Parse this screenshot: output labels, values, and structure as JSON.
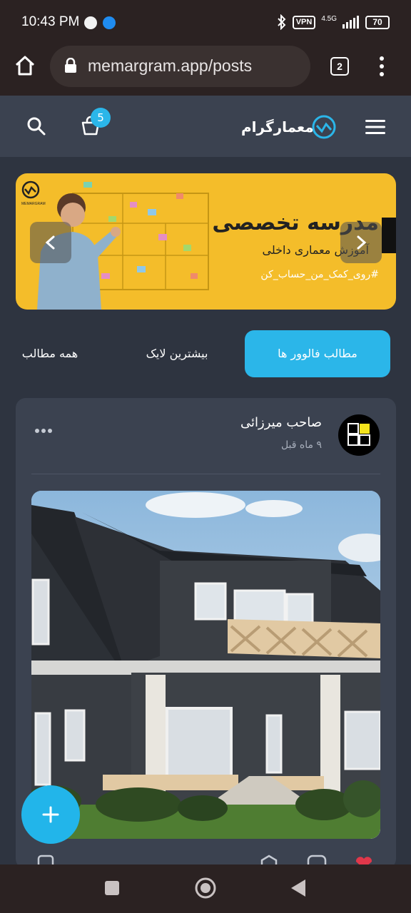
{
  "status": {
    "time": "10:43 PM",
    "vpn": "VPN",
    "network": "4.5G",
    "battery": "70"
  },
  "browser": {
    "url": "memargram.app/posts",
    "tab_count": "2",
    "icons": [
      "home-icon",
      "lock-icon",
      "tabs-icon",
      "more-vertical-icon"
    ]
  },
  "header": {
    "brand": "معمارگرام",
    "cart_count": "5",
    "icons": [
      "menu-icon",
      "logo-icon",
      "cart-icon",
      "search-icon"
    ],
    "accent": "#2bb6e9"
  },
  "banner": {
    "logo_text": "MEMARGRAM",
    "title": "مدرسه تخصصی",
    "subtitle": "آموزش معماری داخلی",
    "hashtag": "#روی_کمک_من_حساب_کن",
    "background": "#f4bd2a"
  },
  "tabs": [
    {
      "label": "مطالب فالوور ها",
      "active": true
    },
    {
      "label": "بیشترین لایک",
      "active": false
    },
    {
      "label": "همه مطالب",
      "active": false
    }
  ],
  "post": {
    "author": "صاحب میرزائی",
    "time": "۹ ماه قبل"
  },
  "fab": {
    "icon": "plus-icon"
  },
  "navbar": {
    "icons": [
      "square-icon",
      "circle-icon",
      "back-triangle-icon"
    ]
  }
}
